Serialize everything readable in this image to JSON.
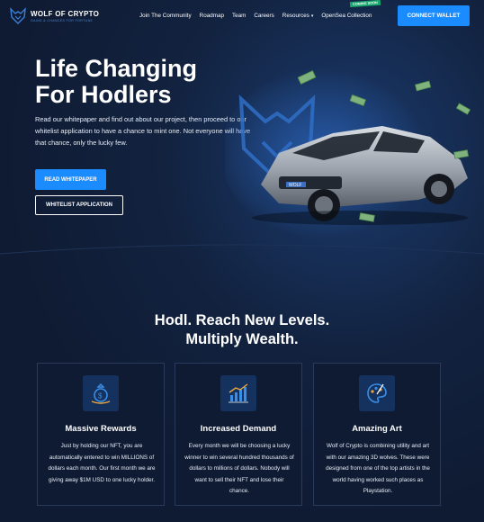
{
  "brand": {
    "name": "WOLF OF CRYPTO",
    "tagline": "GAINS & CHANCES FOR FORTUNE"
  },
  "nav": {
    "links": [
      {
        "label": "Join The Community"
      },
      {
        "label": "Roadmap"
      },
      {
        "label": "Team"
      },
      {
        "label": "Careers"
      },
      {
        "label": "Resources"
      },
      {
        "label": "OpenSea Collection"
      }
    ],
    "coming_soon_badge": "COMING SOON",
    "connect_wallet": "CONNECT WALLET"
  },
  "hero": {
    "title_line1": "Life Changing",
    "title_line2": "For Hodlers",
    "description": "Read our whitepaper and find out about our project, then proceed to our whitelist application to have a chance to mint one. Not everyone will have that chance, only the lucky few.",
    "read_whitepaper": "READ WHITEPAPER",
    "whitelist_application": "WHITELIST APPLICATION",
    "car_plate": "WOLF"
  },
  "section": {
    "title_line1": "Hodl. Reach New Levels.",
    "title_line2": "Multiply Wealth."
  },
  "cards": [
    {
      "icon": "money-bag-icon",
      "title": "Massive Rewards",
      "text": "Just by holding our NFT, you are automatically entered to win MILLIONS of dollars each month. Our first month we are giving away $1M USD to one lucky holder."
    },
    {
      "icon": "growth-chart-icon",
      "title": "Increased Demand",
      "text": "Every month we will be choosing a lucky winner to win several hundred thousands of dollars to millions of dollars. Nobody will want to sell their NFT and lose their chance."
    },
    {
      "icon": "art-palette-icon",
      "title": "Amazing Art",
      "text": "Wolf of Crypto is combining utility and art with our amazing 3D wolves. These were designed from one of the top artists in the world having worked such places as Playstation."
    }
  ],
  "colors": {
    "background": "#0f1b33",
    "accent": "#1a8cff",
    "badge": "#16a56a",
    "card_border": "#2a3a5c"
  }
}
